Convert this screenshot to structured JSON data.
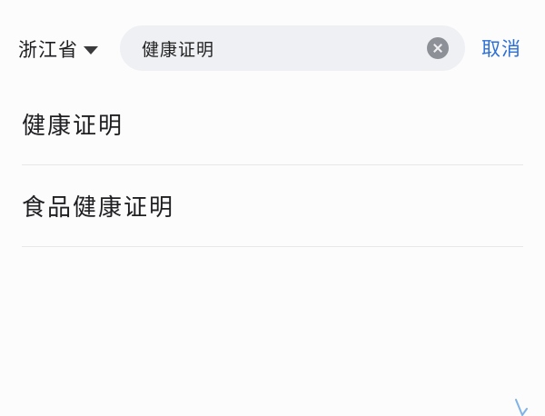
{
  "header": {
    "region_label": "浙江省",
    "search_value": "健康证明",
    "cancel_label": "取消"
  },
  "results": {
    "items": [
      {
        "label": "健康证明"
      },
      {
        "label": "食品健康证明"
      }
    ]
  },
  "colors": {
    "accent": "#2b6fd6",
    "search_bg": "#eef0f3",
    "divider": "#e7e8ea",
    "clear_icon": "#8d9096"
  },
  "icons": {
    "region_dropdown": "caret-down-icon",
    "search_clear": "clear-circle-icon"
  }
}
